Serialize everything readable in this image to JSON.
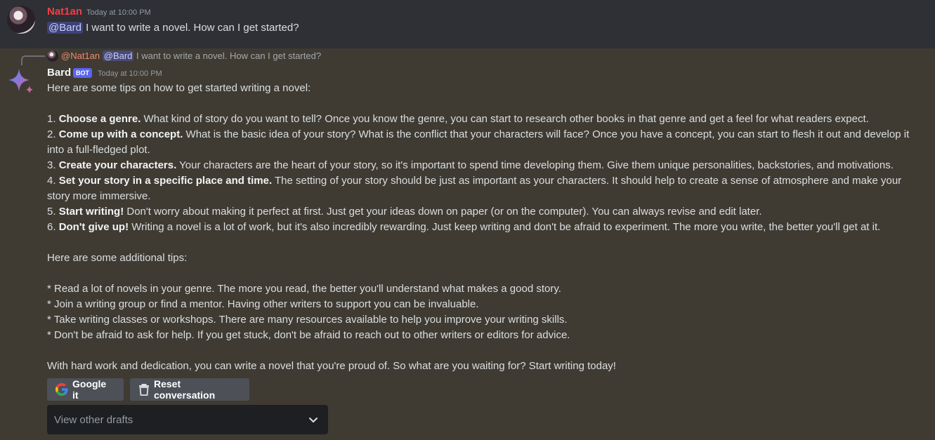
{
  "user_message": {
    "author": "Nat1an",
    "timestamp": "Today at 10:00 PM",
    "mention": "@Bard",
    "text": " I want to write a novel. How can I get started?"
  },
  "reply_preview": {
    "author": "@Nat1an",
    "mention": "@Bard",
    "text": " I want to write a novel. How can I get started?"
  },
  "bot_message": {
    "author": "Bard",
    "tag": "BOT",
    "timestamp": "Today at 10:00 PM",
    "intro": "Here are some tips on how to get started writing a novel:",
    "tips": [
      {
        "prefix": "1. ",
        "bold": "Choose a genre.",
        "text": " What kind of story do you want to tell? Once you know the genre, you can start to research other books in that genre and get a feel for what readers expect."
      },
      {
        "prefix": "2. ",
        "bold": "Come up with a concept.",
        "text": " What is the basic idea of your story? What is the conflict that your characters will face? Once you have a concept, you can start to flesh it out and develop it into a full-fledged plot."
      },
      {
        "prefix": "3. ",
        "bold": "Create your characters.",
        "text": " Your characters are the heart of your story, so it's important to spend time developing them. Give them unique personalities, backstories, and motivations."
      },
      {
        "prefix": "4. ",
        "bold": "Set your story in a specific place and time.",
        "text": " The setting of your story should be just as important as your characters. It should help to create a sense of atmosphere and make your story more immersive."
      },
      {
        "prefix": "5. ",
        "bold": "Start writing!",
        "text": " Don't worry about making it perfect at first. Just get your ideas down on paper (or on the computer). You can always revise and edit later."
      },
      {
        "prefix": "6. ",
        "bold": "Don't give up!",
        "text": " Writing a novel is a lot of work, but it's also incredibly rewarding. Just keep writing and don't be afraid to experiment. The more you write, the better you'll get at it."
      }
    ],
    "additional_heading": "Here are some additional tips:",
    "additional": [
      "* Read a lot of novels in your genre. The more you read, the better you'll understand what makes a good story.",
      "* Join a writing group or find a mentor. Having other writers to support you can be invaluable.",
      "* Take writing classes or workshops. There are many resources available to help you improve your writing skills.",
      "* Don't be afraid to ask for help. If you get stuck, don't be afraid to reach out to other writers or editors for advice."
    ],
    "closing": "With hard work and dedication, you can write a novel that you're proud of. So what are you waiting for? Start writing today!"
  },
  "buttons": {
    "google": "Google it",
    "reset": "Reset conversation"
  },
  "drafts_select": {
    "placeholder": "View other drafts"
  },
  "icons": {
    "google": "google-g-icon",
    "reset": "trash-icon",
    "dropdown": "chevron-down-icon",
    "bard": "bard-sparkle-icon"
  }
}
